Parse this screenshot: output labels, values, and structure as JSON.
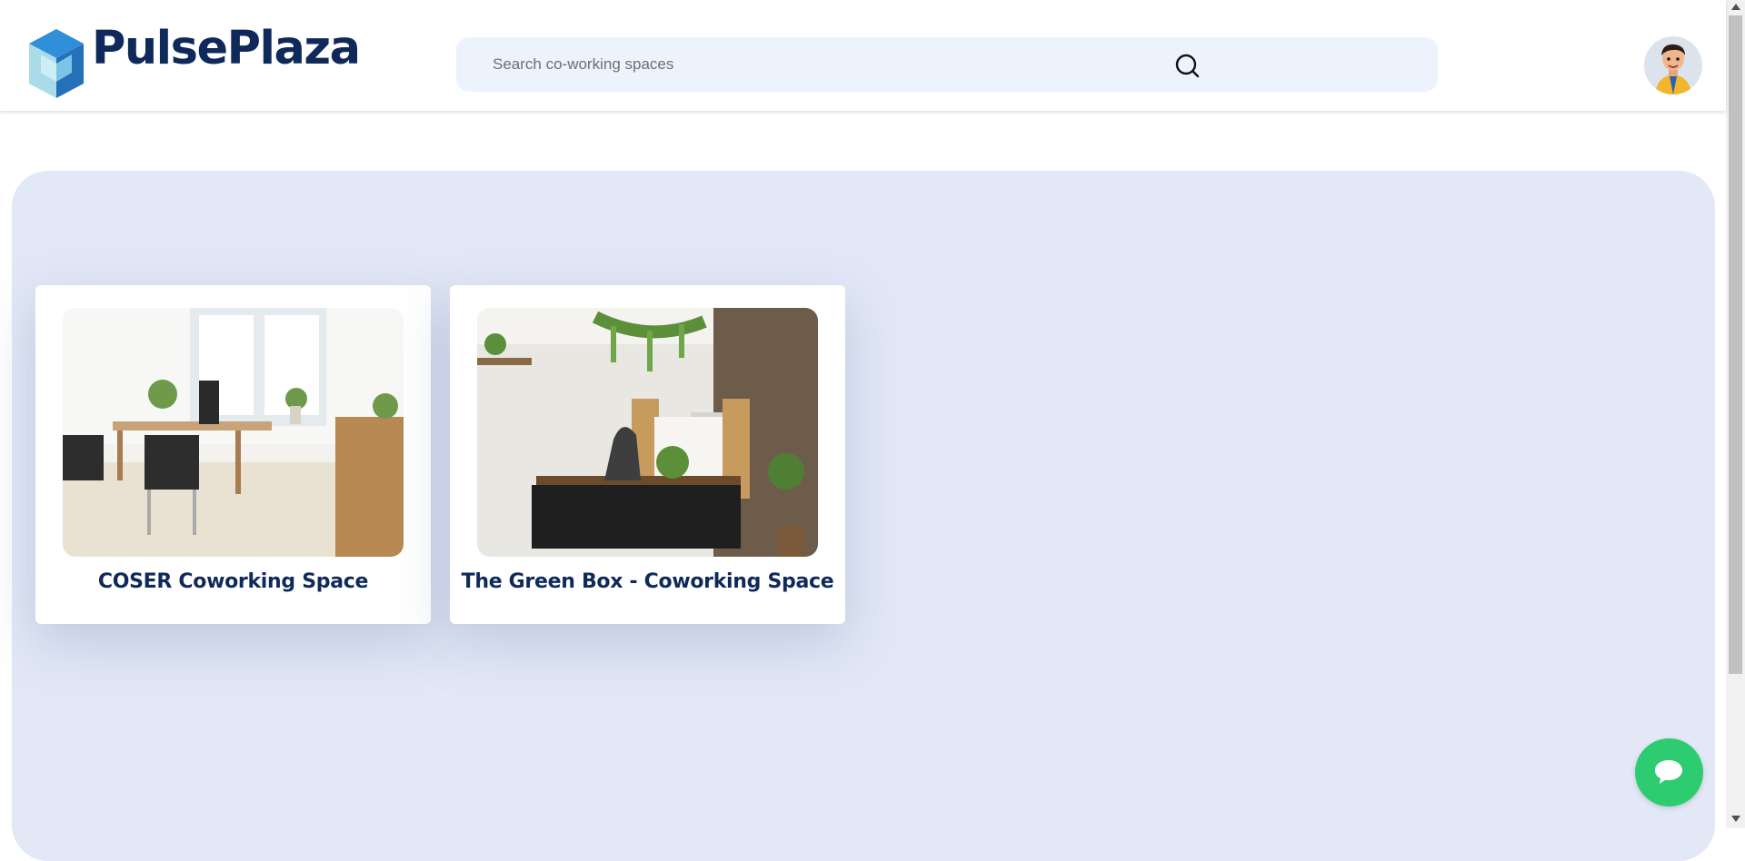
{
  "header": {
    "brand_name": "PulsePlaza",
    "logo_icon": "cube-logo-icon",
    "search": {
      "placeholder": "Search co-working spaces",
      "value": "",
      "icon": "search-icon"
    },
    "avatar_icon": "user-avatar-icon"
  },
  "main": {
    "spaces": [
      {
        "title": "COSER Coworking Space",
        "image": "office-photo-coser"
      },
      {
        "title": "The Green Box - Coworking Space",
        "image": "office-photo-green-box"
      }
    ]
  },
  "chat": {
    "icon": "chat-bubble-icon",
    "color": "#2ecc71"
  },
  "colors": {
    "brand": "#0f2a5a",
    "accent_blue": "#2f8fd9",
    "panel_background": "#e2e8f6",
    "search_background": "#edf3fd"
  }
}
